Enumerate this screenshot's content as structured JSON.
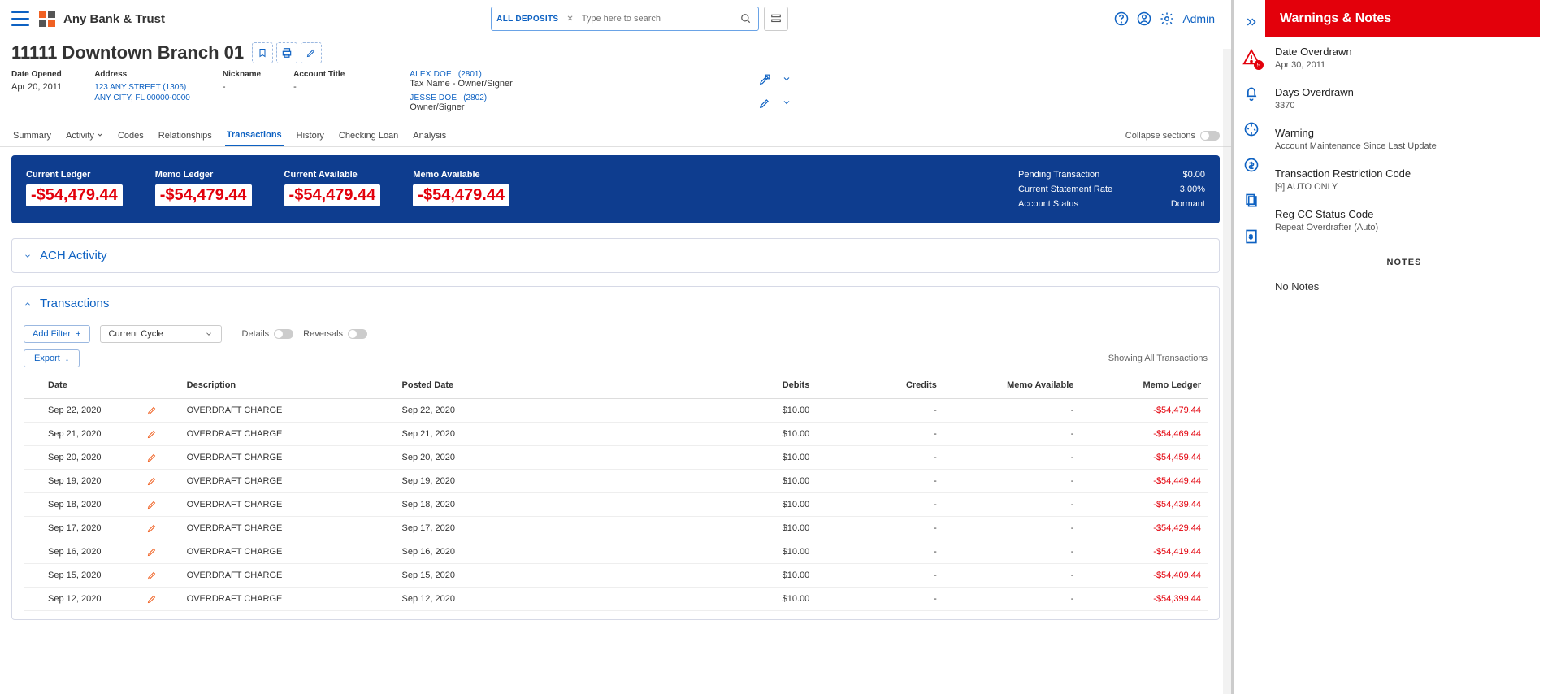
{
  "header": {
    "bank_name": "Any Bank & Trust",
    "search_category": "ALL DEPOSITS",
    "search_placeholder": "Type here to search",
    "admin_label": "Admin"
  },
  "account": {
    "title": "11111 Downtown Branch 01",
    "date_opened_label": "Date Opened",
    "date_opened": "Apr 20, 2011",
    "address_label": "Address",
    "address_line1": "123 ANY STREET (1306)",
    "address_line2": "ANY CITY, FL 00000-0000",
    "nickname_label": "Nickname",
    "nickname": "-",
    "account_title_label": "Account Title",
    "account_title": "-",
    "persons": [
      {
        "name": "ALEX DOE",
        "pid": "(2801)",
        "role": "Tax Name - Owner/Signer"
      },
      {
        "name": "JESSE DOE",
        "pid": "(2802)",
        "role": "Owner/Signer"
      }
    ]
  },
  "tabs": {
    "items": [
      "Summary",
      "Activity",
      "Codes",
      "Relationships",
      "Transactions",
      "History",
      "Checking Loan",
      "Analysis"
    ],
    "active_index": 4,
    "collapse_label": "Collapse sections"
  },
  "summary": {
    "current_ledger_label": "Current Ledger",
    "current_ledger": "-$54,479.44",
    "memo_ledger_label": "Memo Ledger",
    "memo_ledger": "-$54,479.44",
    "current_available_label": "Current Available",
    "current_available": "-$54,479.44",
    "memo_available_label": "Memo Available",
    "memo_available": "-$54,479.44",
    "pending_transaction_label": "Pending Transaction",
    "pending_transaction": "$0.00",
    "statement_rate_label": "Current Statement Rate",
    "statement_rate": "3.00%",
    "account_status_label": "Account Status",
    "account_status": "Dormant"
  },
  "sections": {
    "ach_title": "ACH Activity",
    "transactions_title": "Transactions"
  },
  "filters": {
    "add_filter": "Add Filter",
    "cycle": "Current Cycle",
    "details_label": "Details",
    "reversals_label": "Reversals",
    "export": "Export",
    "showing": "Showing All Transactions"
  },
  "table": {
    "headers": {
      "date": "Date",
      "description": "Description",
      "posted": "Posted Date",
      "debits": "Debits",
      "credits": "Credits",
      "memo_available": "Memo Available",
      "memo_ledger": "Memo Ledger"
    },
    "rows": [
      {
        "date": "Sep 22, 2020",
        "desc": "OVERDRAFT CHARGE",
        "posted": "Sep 22, 2020",
        "debits": "$10.00",
        "credits": "-",
        "memo_av": "-",
        "memo_led": "-$54,479.44"
      },
      {
        "date": "Sep 21, 2020",
        "desc": "OVERDRAFT CHARGE",
        "posted": "Sep 21, 2020",
        "debits": "$10.00",
        "credits": "-",
        "memo_av": "-",
        "memo_led": "-$54,469.44"
      },
      {
        "date": "Sep 20, 2020",
        "desc": "OVERDRAFT CHARGE",
        "posted": "Sep 20, 2020",
        "debits": "$10.00",
        "credits": "-",
        "memo_av": "-",
        "memo_led": "-$54,459.44"
      },
      {
        "date": "Sep 19, 2020",
        "desc": "OVERDRAFT CHARGE",
        "posted": "Sep 19, 2020",
        "debits": "$10.00",
        "credits": "-",
        "memo_av": "-",
        "memo_led": "-$54,449.44"
      },
      {
        "date": "Sep 18, 2020",
        "desc": "OVERDRAFT CHARGE",
        "posted": "Sep 18, 2020",
        "debits": "$10.00",
        "credits": "-",
        "memo_av": "-",
        "memo_led": "-$54,439.44"
      },
      {
        "date": "Sep 17, 2020",
        "desc": "OVERDRAFT CHARGE",
        "posted": "Sep 17, 2020",
        "debits": "$10.00",
        "credits": "-",
        "memo_av": "-",
        "memo_led": "-$54,429.44"
      },
      {
        "date": "Sep 16, 2020",
        "desc": "OVERDRAFT CHARGE",
        "posted": "Sep 16, 2020",
        "debits": "$10.00",
        "credits": "-",
        "memo_av": "-",
        "memo_led": "-$54,419.44"
      },
      {
        "date": "Sep 15, 2020",
        "desc": "OVERDRAFT CHARGE",
        "posted": "Sep 15, 2020",
        "debits": "$10.00",
        "credits": "-",
        "memo_av": "-",
        "memo_led": "-$54,409.44"
      },
      {
        "date": "Sep 12, 2020",
        "desc": "OVERDRAFT CHARGE",
        "posted": "Sep 12, 2020",
        "debits": "$10.00",
        "credits": "-",
        "memo_av": "-",
        "memo_led": "-$54,399.44"
      }
    ]
  },
  "warnings": {
    "header": "Warnings & Notes",
    "items": [
      {
        "title": "Date Overdrawn",
        "detail": "Apr 30, 2011"
      },
      {
        "title": "Days Overdrawn",
        "detail": "3370"
      },
      {
        "title": "Warning",
        "detail": "Account Maintenance Since Last Update"
      },
      {
        "title": "Transaction Restriction Code",
        "detail": "[9] AUTO ONLY"
      },
      {
        "title": "Reg CC Status Code",
        "detail": "Repeat Overdrafter (Auto)"
      }
    ],
    "notes_header": "NOTES",
    "no_notes": "No Notes"
  }
}
